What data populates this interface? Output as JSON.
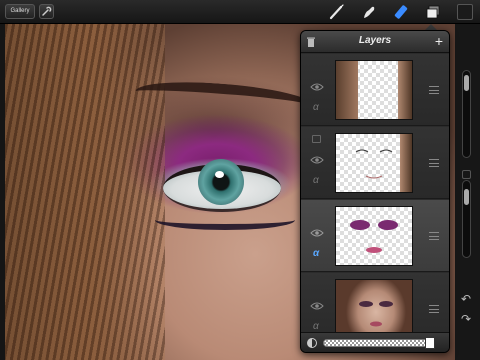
{
  "toolbar": {
    "gallery_label": "Gallery",
    "tools": [
      {
        "name": "brush-icon"
      },
      {
        "name": "smudge-icon"
      },
      {
        "name": "eraser-icon",
        "active": true
      },
      {
        "name": "layers-icon",
        "active": true
      }
    ],
    "accent_color": "#3a8bff"
  },
  "layers_panel": {
    "title": "Layers",
    "add_icon": "+",
    "layers": [
      {
        "thumbnail": "hair-sketch",
        "visible": true,
        "alpha_lock": false,
        "selected": false
      },
      {
        "thumbnail": "face-outline",
        "visible": true,
        "alpha_lock": false,
        "selected": false,
        "has_mask": true
      },
      {
        "thumbnail": "eyes-and-lips",
        "visible": true,
        "alpha_lock": true,
        "selected": true
      },
      {
        "thumbnail": "portrait-photo",
        "visible": true,
        "alpha_lock": false,
        "selected": false
      }
    ],
    "alpha_symbol": "α",
    "opacity": 1.0
  },
  "right_rail": {
    "undo_symbol": "↶",
    "redo_symbol": "↷"
  }
}
